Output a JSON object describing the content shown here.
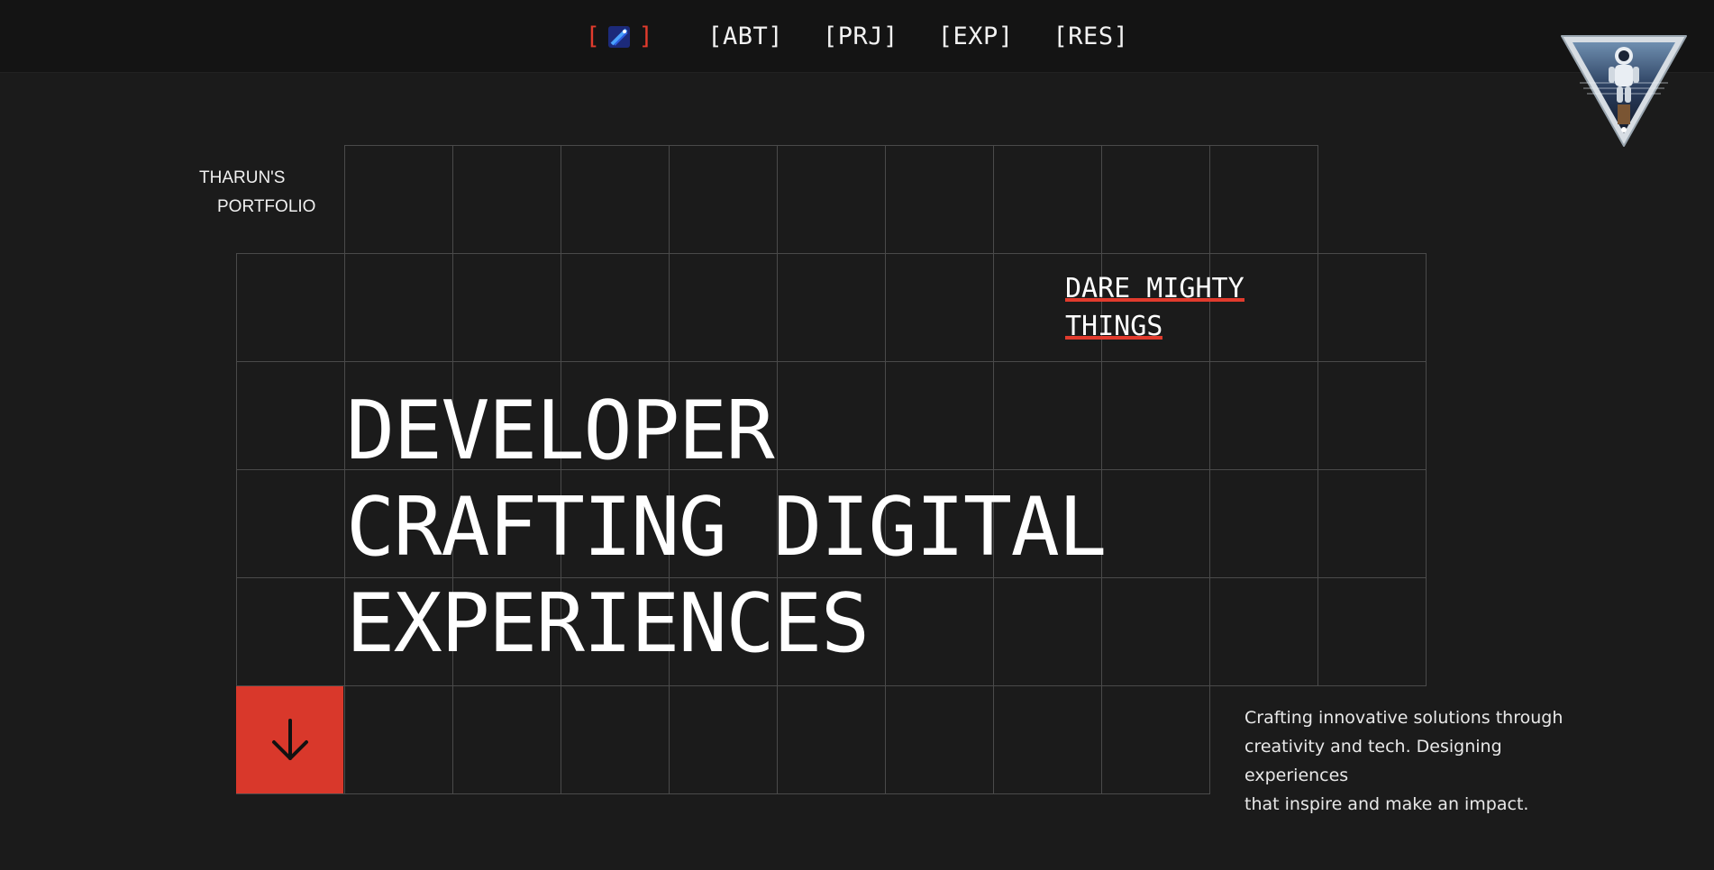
{
  "nav": {
    "home_label_open": "[",
    "home_label_close": "]",
    "home_icon": "rocket-icon",
    "items": [
      {
        "label": "[ABT]"
      },
      {
        "label": "[PRJ]"
      },
      {
        "label": "[EXP]"
      },
      {
        "label": "[RES]"
      }
    ]
  },
  "badge": {
    "icon": "astronaut-triangle-emblem"
  },
  "brand": {
    "line1": "THARUN'S",
    "line2": "PORTFOLIO"
  },
  "motto": {
    "line1": "DARE MIGHTY",
    "line2": "THINGS"
  },
  "headline": {
    "line1": "DEVELOPER",
    "line2": "CRAFTING DIGITAL",
    "line3": "EXPERIENCES"
  },
  "scroll_button": {
    "icon": "arrow-down-icon"
  },
  "tagline": {
    "line1": "Crafting innovative solutions through",
    "line2": "creativity and tech. Designing experiences",
    "line3": "that inspire and make an impact."
  },
  "colors": {
    "background": "#1b1b1b",
    "topbar": "#141414",
    "accent": "#e13b2d",
    "grid_line": "#4a4a4a",
    "text": "#ffffff"
  }
}
